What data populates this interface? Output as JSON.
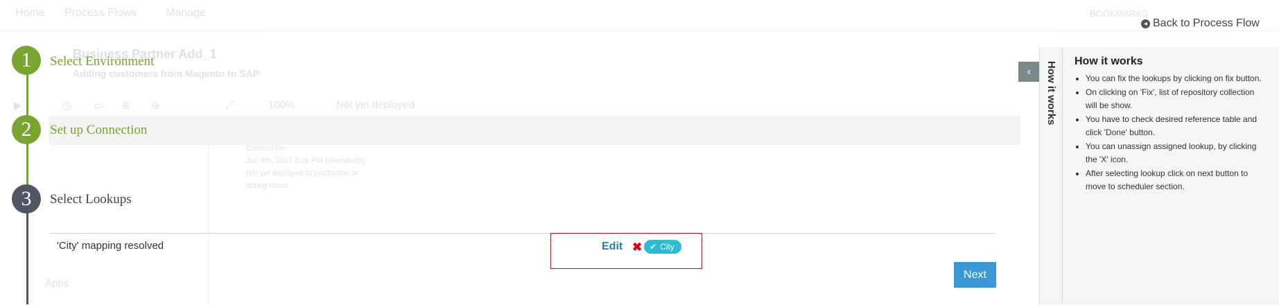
{
  "background": {
    "nav": [
      "Home",
      "Process Flows",
      "Manage",
      "BOOKMARKS"
    ],
    "title": "Business Partner Add_1",
    "subtitle": "Adding customers from Magento to SAP",
    "zoom": "100%",
    "deploy_status": "Not yet deployed",
    "apps_label": "Apps",
    "notes": [
      "Created On",
      "Jun 8th, 2017 3:06 PM (sheralinda)",
      "Not yet deployed to production or",
      "debug mode"
    ]
  },
  "back_link": "Back to Process Flow",
  "steps": [
    {
      "number": "1",
      "label": "Select Environment",
      "color": "#77a52f"
    },
    {
      "number": "2",
      "label": "Set up Connection",
      "color": "#77a52f"
    },
    {
      "number": "3",
      "label": "Select Lookups",
      "color": "#4f5662"
    }
  ],
  "mapping": {
    "status_text": "'City' mapping resolved",
    "edit_label": "Edit",
    "remove_icon": "close-x-icon",
    "tag_label": "City"
  },
  "next_label": "Next",
  "how_it_works": {
    "tab_label": "How it works",
    "title": "How it works",
    "items": [
      "You can fix the lookups by clicking on fix button.",
      "On clicking on 'Fix', list of repository collection will be show.",
      "You have to check desired reference table and click 'Done' button.",
      "You can unassign assigned lookup, by clicking the 'X' icon.",
      "After selecting lookup click on next button to move to scheduler section."
    ]
  }
}
